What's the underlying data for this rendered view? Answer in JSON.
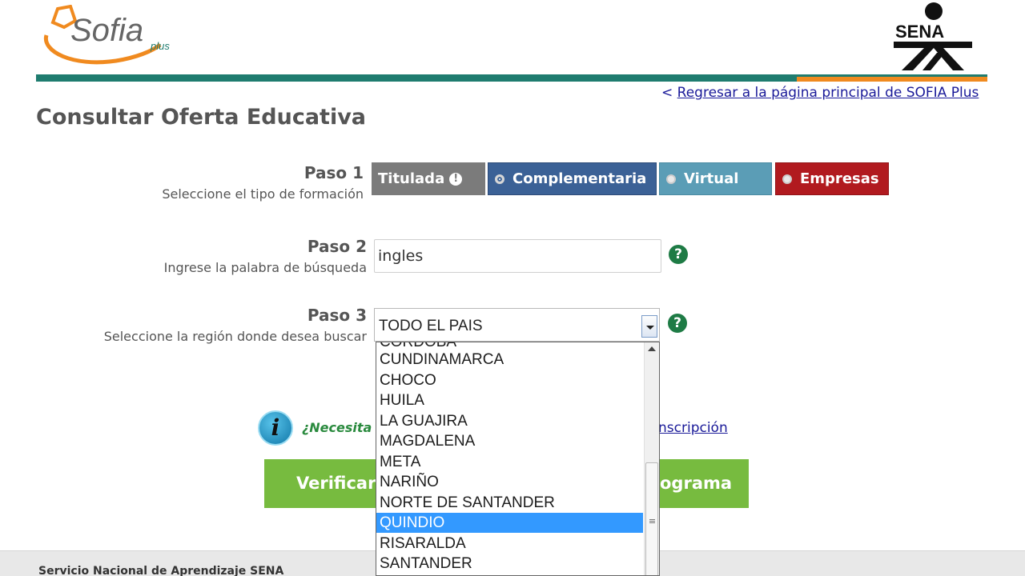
{
  "header": {
    "sofia_logo_text": "Sofia",
    "sofia_logo_sub": "plus",
    "sena_logo_text": "SENA",
    "back_link_prefix": "<",
    "back_link_text": "Regresar a la página principal de SOFIA Plus"
  },
  "page_title": "Consultar Oferta Educativa",
  "step1": {
    "label": "Paso 1",
    "desc": "Seleccione el tipo de formación",
    "options": [
      {
        "label": "Titulada",
        "color": "#7b7b7b"
      },
      {
        "label": "Complementaria",
        "color": "#3b6196",
        "selected": true
      },
      {
        "label": "Virtual",
        "color": "#5b9db6"
      },
      {
        "label": "Empresas",
        "color": "#b11a1f"
      }
    ],
    "titulada_badge": "!"
  },
  "step2": {
    "label": "Paso 2",
    "desc": "Ingrese la palabra de búsqueda",
    "input_value": "ingles",
    "help": "?"
  },
  "step3": {
    "label": "Paso 3",
    "desc": "Seleccione la región donde desea buscar",
    "selected_value": "TODO EL PAIS",
    "help": "?",
    "dropdown_partial_top": "CORDOBA",
    "dropdown_items": [
      "CUNDINAMARCA",
      "CHOCO",
      "HUILA",
      "LA GUAJIRA",
      "MAGDALENA",
      "META",
      "NARIÑO",
      "NORTE DE SANTANDER",
      "QUINDIO",
      "RISARALDA",
      "SANTANDER"
    ],
    "highlighted_item": "QUINDIO"
  },
  "info": {
    "icon_letter": "i",
    "text_visible": "¿Necesita",
    "link_visible": "nscripción"
  },
  "buttons": {
    "verify_visible": "Verificar",
    "program_visible": "ograma"
  },
  "footer": {
    "text": "Servicio Nacional de Aprendizaje SENA"
  }
}
